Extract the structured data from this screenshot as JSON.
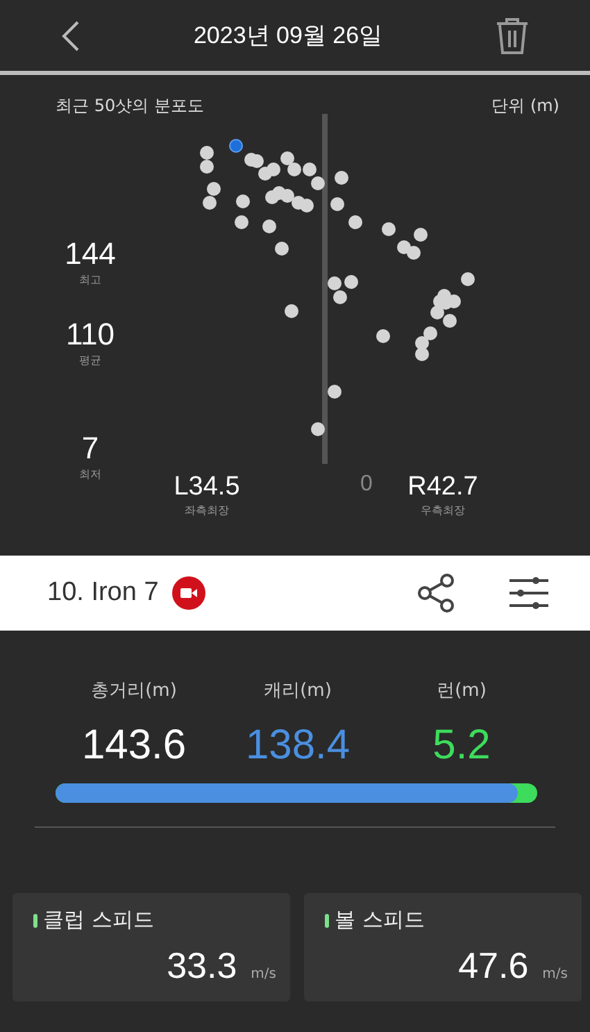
{
  "header": {
    "title": "2023년 09월 26일"
  },
  "chart": {
    "title": "최근 50샷의 분포도",
    "unit": "단위 (m)",
    "stats": [
      {
        "value": "144",
        "label": "최고"
      },
      {
        "value": "110",
        "label": "평균"
      },
      {
        "value": "7",
        "label": "최저"
      }
    ],
    "left": {
      "value": "L34.5",
      "label": "좌측최장"
    },
    "center_label": "0",
    "right": {
      "value": "R42.7",
      "label": "우측최장"
    }
  },
  "club": {
    "name": "10. Iron 7"
  },
  "totals": [
    {
      "kind": "total",
      "label": "총거리(m)",
      "value": "143.6"
    },
    {
      "kind": "carry",
      "label": "캐리(m)",
      "value": "138.4"
    },
    {
      "kind": "run",
      "label": "런(m)",
      "value": "5.2"
    }
  ],
  "distance_bar": {
    "level": 0.96
  },
  "speeds": [
    {
      "label": "클럽 스피드",
      "value": "33.3",
      "unit": "m/s"
    },
    {
      "label": "볼 스피드",
      "value": "47.6",
      "unit": "m/s"
    }
  ]
}
